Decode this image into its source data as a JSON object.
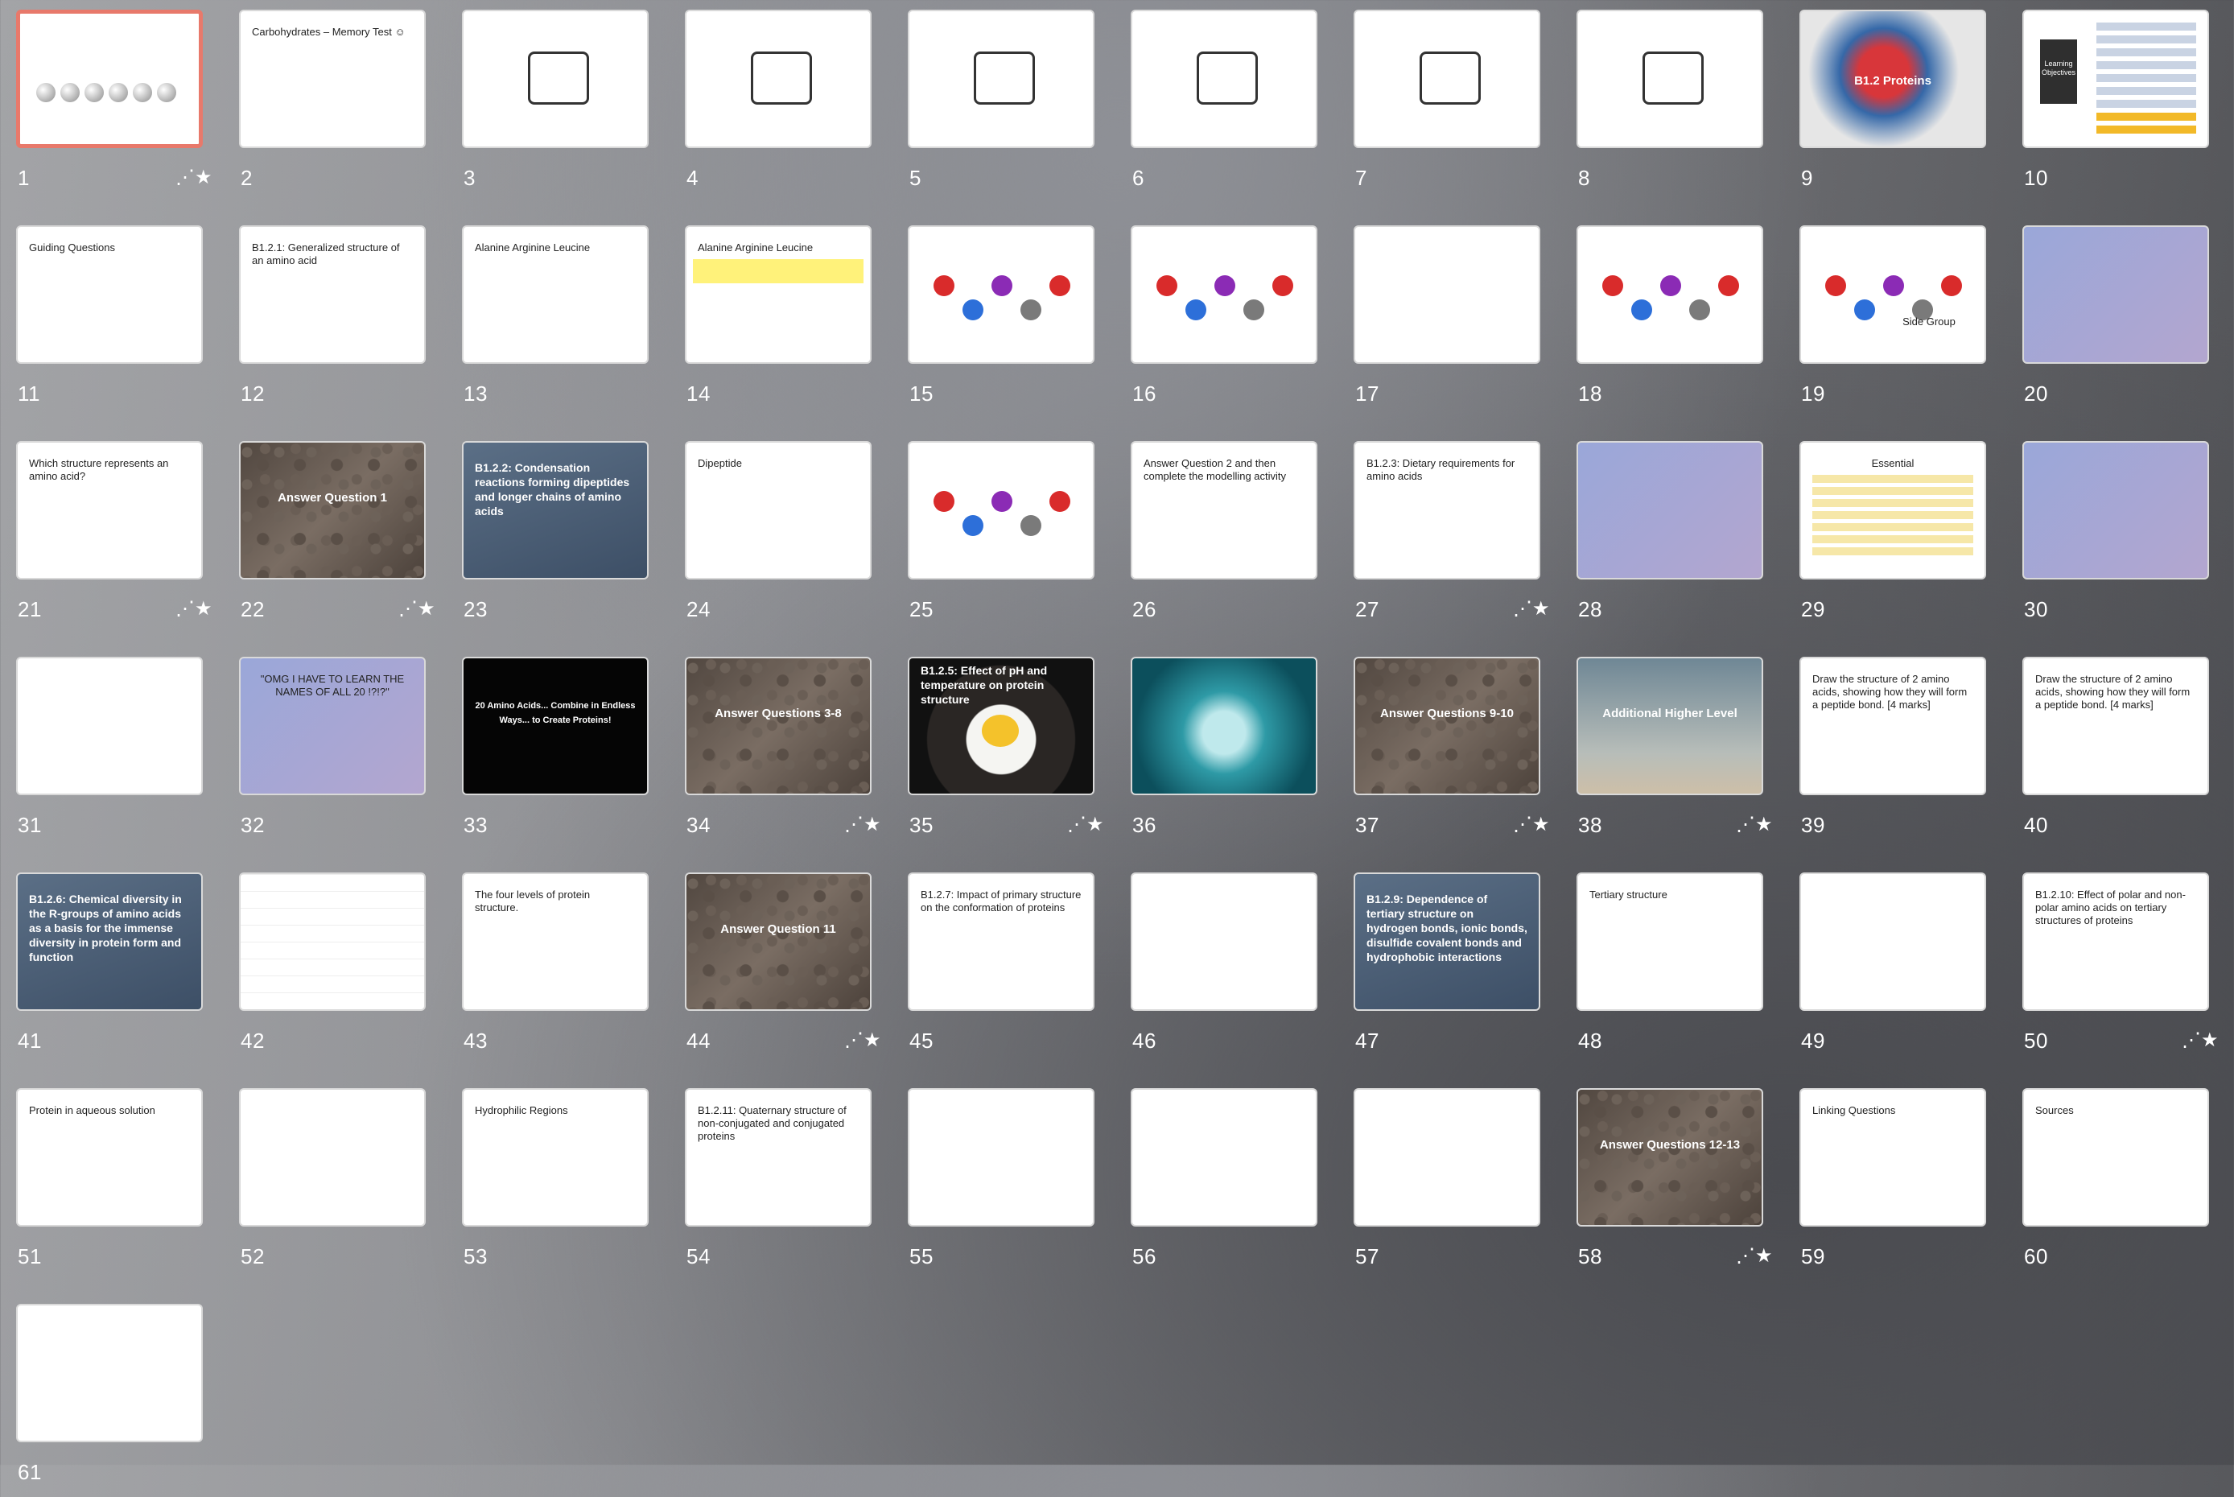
{
  "view": "slide-sorter",
  "colors": {
    "selection": "#e8796b",
    "label": "#ffffff"
  },
  "slides": [
    {
      "n": "1",
      "anim": true,
      "selected": true,
      "style": "pendulum"
    },
    {
      "n": "2",
      "style": "white",
      "text": "Carbohydrates – Memory Test ☺"
    },
    {
      "n": "3",
      "style": "ring"
    },
    {
      "n": "4",
      "style": "ring"
    },
    {
      "n": "5",
      "style": "ring"
    },
    {
      "n": "6",
      "style": "ring"
    },
    {
      "n": "7",
      "style": "ring"
    },
    {
      "n": "8",
      "style": "ring"
    },
    {
      "n": "9",
      "style": "protein",
      "text": "B1.2 Proteins"
    },
    {
      "n": "10",
      "style": "objectives",
      "text": "Learning Objectives"
    },
    {
      "n": "11",
      "style": "white",
      "text": "Guiding Questions"
    },
    {
      "n": "12",
      "style": "white",
      "text": "B1.2.1: Generalized structure of an amino acid"
    },
    {
      "n": "13",
      "style": "white",
      "text": "Alanine    Arginine    Leucine"
    },
    {
      "n": "14",
      "style": "yellow",
      "text": "Alanine    Arginine    Leucine"
    },
    {
      "n": "15",
      "style": "molecule"
    },
    {
      "n": "16",
      "style": "molecule"
    },
    {
      "n": "17",
      "style": "photo"
    },
    {
      "n": "18",
      "style": "molecule"
    },
    {
      "n": "19",
      "style": "sidegroup",
      "text": "Side Group"
    },
    {
      "n": "20",
      "style": "purple"
    },
    {
      "n": "21",
      "anim": true,
      "style": "white",
      "text": "Which structure represents an amino acid?"
    },
    {
      "n": "22",
      "anim": true,
      "style": "beads",
      "text": "Answer Question 1"
    },
    {
      "n": "23",
      "style": "blue",
      "text": "B1.2.2: Condensation reactions forming dipeptides and longer chains of amino acids"
    },
    {
      "n": "24",
      "style": "white",
      "text": "Dipeptide"
    },
    {
      "n": "25",
      "style": "molecule"
    },
    {
      "n": "26",
      "style": "white",
      "text": "Answer Question 2 and then complete the modelling activity"
    },
    {
      "n": "27",
      "anim": true,
      "style": "white",
      "text": "B1.2.3: Dietary requirements for amino acids"
    },
    {
      "n": "28",
      "style": "purple"
    },
    {
      "n": "29",
      "style": "table",
      "text": "Essential"
    },
    {
      "n": "30",
      "style": "purple"
    },
    {
      "n": "31",
      "style": "white"
    },
    {
      "n": "32",
      "style": "purple",
      "text": "\"OMG I HAVE TO LEARN THE NAMES OF ALL 20 !?!?\""
    },
    {
      "n": "33",
      "style": "black",
      "text": "20 Amino Acids... Combine in Endless Ways... to Create Proteins!"
    },
    {
      "n": "34",
      "anim": true,
      "style": "beads",
      "text": "Answer Questions 3-8"
    },
    {
      "n": "35",
      "anim": true,
      "style": "egg",
      "text": "B1.2.5: Effect of pH and temperature on protein structure"
    },
    {
      "n": "36",
      "style": "ocean"
    },
    {
      "n": "37",
      "anim": true,
      "style": "beads",
      "text": "Answer Questions 9-10"
    },
    {
      "n": "38",
      "anim": true,
      "style": "sky",
      "text": "Additional Higher Level"
    },
    {
      "n": "39",
      "style": "white",
      "text": "Draw the structure of 2 amino acids, showing how they will form a peptide bond. [4 marks]"
    },
    {
      "n": "40",
      "style": "white",
      "text": "Draw the structure of 2 amino acids, showing how they will form a peptide bond. [4 marks]"
    },
    {
      "n": "41",
      "style": "blue",
      "text": "B1.2.6: Chemical diversity in the R-groups of amino acids as a basis for the immense diversity in protein form and function"
    },
    {
      "n": "42",
      "style": "grid"
    },
    {
      "n": "43",
      "style": "white",
      "text": "The four levels of protein structure."
    },
    {
      "n": "44",
      "anim": true,
      "style": "beads",
      "text": "Answer Question 11"
    },
    {
      "n": "45",
      "style": "white",
      "text": "B1.2.7: Impact of primary structure on the conformation of proteins"
    },
    {
      "n": "46",
      "style": "white"
    },
    {
      "n": "47",
      "style": "blue",
      "text": "B1.2.9: Dependence of tertiary structure on hydrogen bonds, ionic bonds, disulfide covalent bonds and hydrophobic interactions"
    },
    {
      "n": "48",
      "style": "white",
      "text": "Tertiary structure"
    },
    {
      "n": "49",
      "style": "white"
    },
    {
      "n": "50",
      "anim": true,
      "style": "white",
      "text": "B1.2.10: Effect of polar and non-polar amino acids on tertiary structures of proteins"
    },
    {
      "n": "51",
      "style": "white",
      "text": "Protein in aqueous solution"
    },
    {
      "n": "52",
      "style": "white"
    },
    {
      "n": "53",
      "style": "white",
      "text": "Hydrophilic Regions"
    },
    {
      "n": "54",
      "style": "white",
      "text": "B1.2.11: Quaternary structure of non-conjugated and conjugated proteins"
    },
    {
      "n": "55",
      "style": "white"
    },
    {
      "n": "56",
      "style": "white"
    },
    {
      "n": "57",
      "style": "white"
    },
    {
      "n": "58",
      "anim": true,
      "style": "beads",
      "text": "Answer Questions 12-13"
    },
    {
      "n": "59",
      "style": "white",
      "text": "Linking Questions"
    },
    {
      "n": "60",
      "style": "white",
      "text": "Sources"
    },
    {
      "n": "61",
      "style": "white"
    }
  ]
}
